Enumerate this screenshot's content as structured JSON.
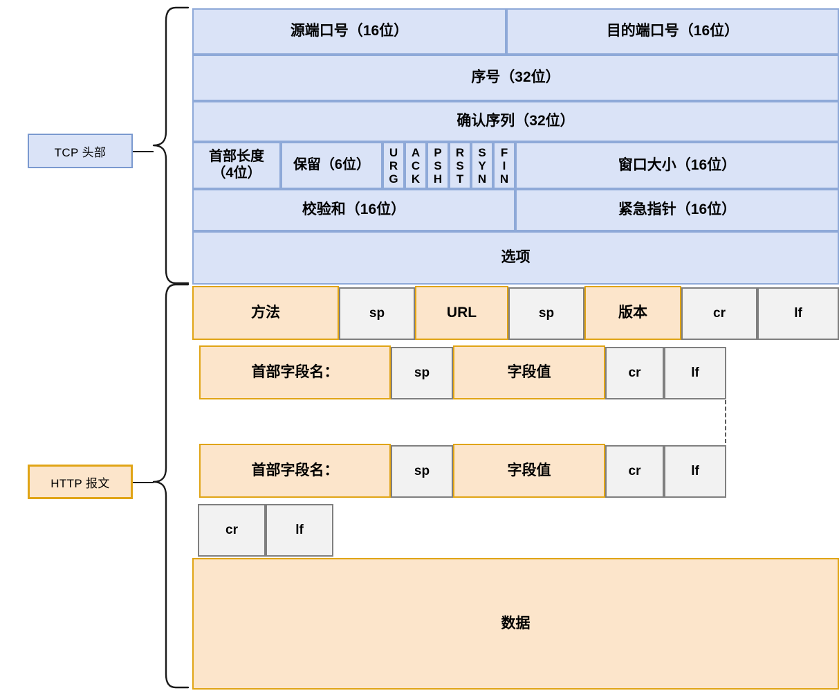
{
  "diagram": {
    "title_labels": {
      "tcp": "TCP 头部",
      "http": "HTTP 报文"
    },
    "tcp_header": {
      "fill_color": "#dae3f7",
      "border_color": "#8ea9d8",
      "rows": [
        {
          "cells": [
            {
              "label": "源端口号（16位）"
            },
            {
              "label": "目的端口号（16位）"
            }
          ]
        },
        {
          "cells": [
            {
              "label": "序号（32位）"
            }
          ]
        },
        {
          "cells": [
            {
              "label": "确认序列（32位）"
            }
          ]
        },
        {
          "cells": [
            {
              "label": "首部长度\n（4位）"
            },
            {
              "label": "保留（6位）"
            },
            {
              "label": "URG"
            },
            {
              "label": "ACK"
            },
            {
              "label": "PSH"
            },
            {
              "label": "RST"
            },
            {
              "label": "SYN"
            },
            {
              "label": "FIN"
            },
            {
              "label": "窗口大小（16位）"
            }
          ]
        },
        {
          "cells": [
            {
              "label": "校验和（16位）"
            },
            {
              "label": "紧急指针（16位）"
            }
          ]
        },
        {
          "cells": [
            {
              "label": "选项"
            }
          ]
        }
      ]
    },
    "http_message": {
      "fill_color": "#fce5cb",
      "border_color": "#e0a415",
      "neutral_fill": "#f2f2f2",
      "neutral_border": "#7f7f7f",
      "request_line": [
        {
          "label": "方法",
          "kind": "orange"
        },
        {
          "label": "sp",
          "kind": "gray"
        },
        {
          "label": "URL",
          "kind": "orange"
        },
        {
          "label": "sp",
          "kind": "gray"
        },
        {
          "label": "版本",
          "kind": "orange"
        },
        {
          "label": "cr",
          "kind": "gray"
        },
        {
          "label": "lf",
          "kind": "gray"
        }
      ],
      "header_line_1": [
        {
          "label": "首部字段名：",
          "kind": "orange"
        },
        {
          "label": "sp",
          "kind": "gray"
        },
        {
          "label": "字段值",
          "kind": "orange"
        },
        {
          "label": "cr",
          "kind": "gray"
        },
        {
          "label": "lf",
          "kind": "gray"
        }
      ],
      "header_line_2": [
        {
          "label": "首部字段名：",
          "kind": "orange"
        },
        {
          "label": "sp",
          "kind": "gray"
        },
        {
          "label": "字段值",
          "kind": "orange"
        },
        {
          "label": "cr",
          "kind": "gray"
        },
        {
          "label": "lf",
          "kind": "gray"
        }
      ],
      "blank_line": [
        {
          "label": "cr",
          "kind": "gray"
        },
        {
          "label": "lf",
          "kind": "gray"
        }
      ],
      "body": {
        "label": "数据",
        "kind": "orange"
      }
    }
  }
}
